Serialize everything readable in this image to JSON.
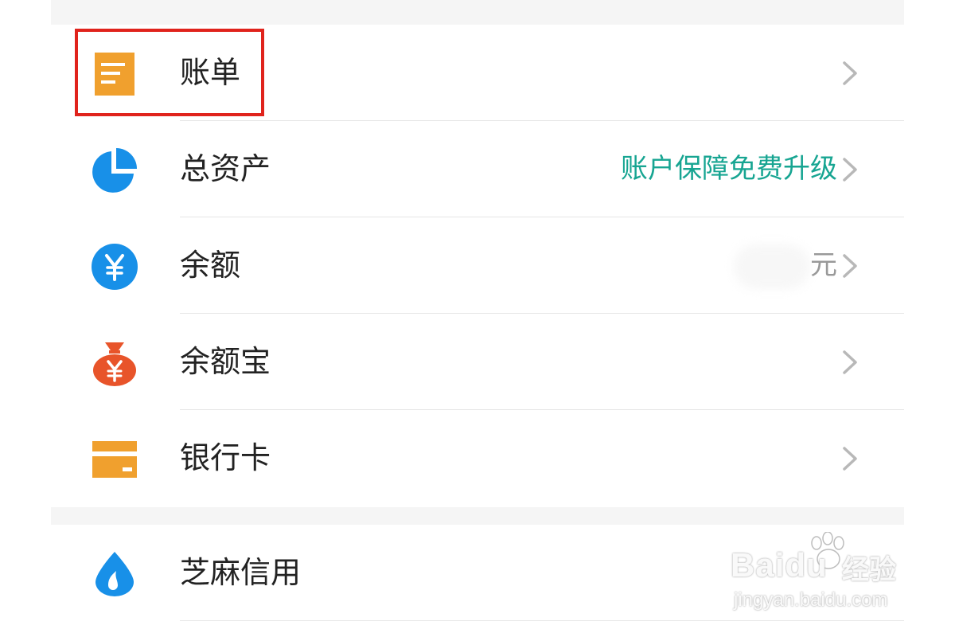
{
  "menu_group_1": {
    "items": [
      {
        "label": "账单",
        "icon": "bill-icon",
        "color": "#f0a02e"
      },
      {
        "label": "总资产",
        "icon": "pie-chart-icon",
        "color": "#1890e8",
        "promo_text": "账户保障免费升级",
        "promo_color": "#17a592"
      },
      {
        "label": "余额",
        "icon": "yuan-coin-icon",
        "color": "#1890e8",
        "unit": "元"
      },
      {
        "label": "余额宝",
        "icon": "money-bag-icon",
        "color": "#e8542a"
      },
      {
        "label": "银行卡",
        "icon": "bank-card-icon",
        "color": "#f0a02e"
      }
    ]
  },
  "menu_group_2": {
    "items": [
      {
        "label": "芝麻信用",
        "icon": "sesame-drop-icon",
        "color": "#1890e8"
      }
    ]
  },
  "highlight": {
    "target": "账单",
    "color": "#e0231c"
  },
  "watermark": {
    "brand": "Baidu",
    "product": "经验",
    "url": "jingyan.baidu.com"
  }
}
